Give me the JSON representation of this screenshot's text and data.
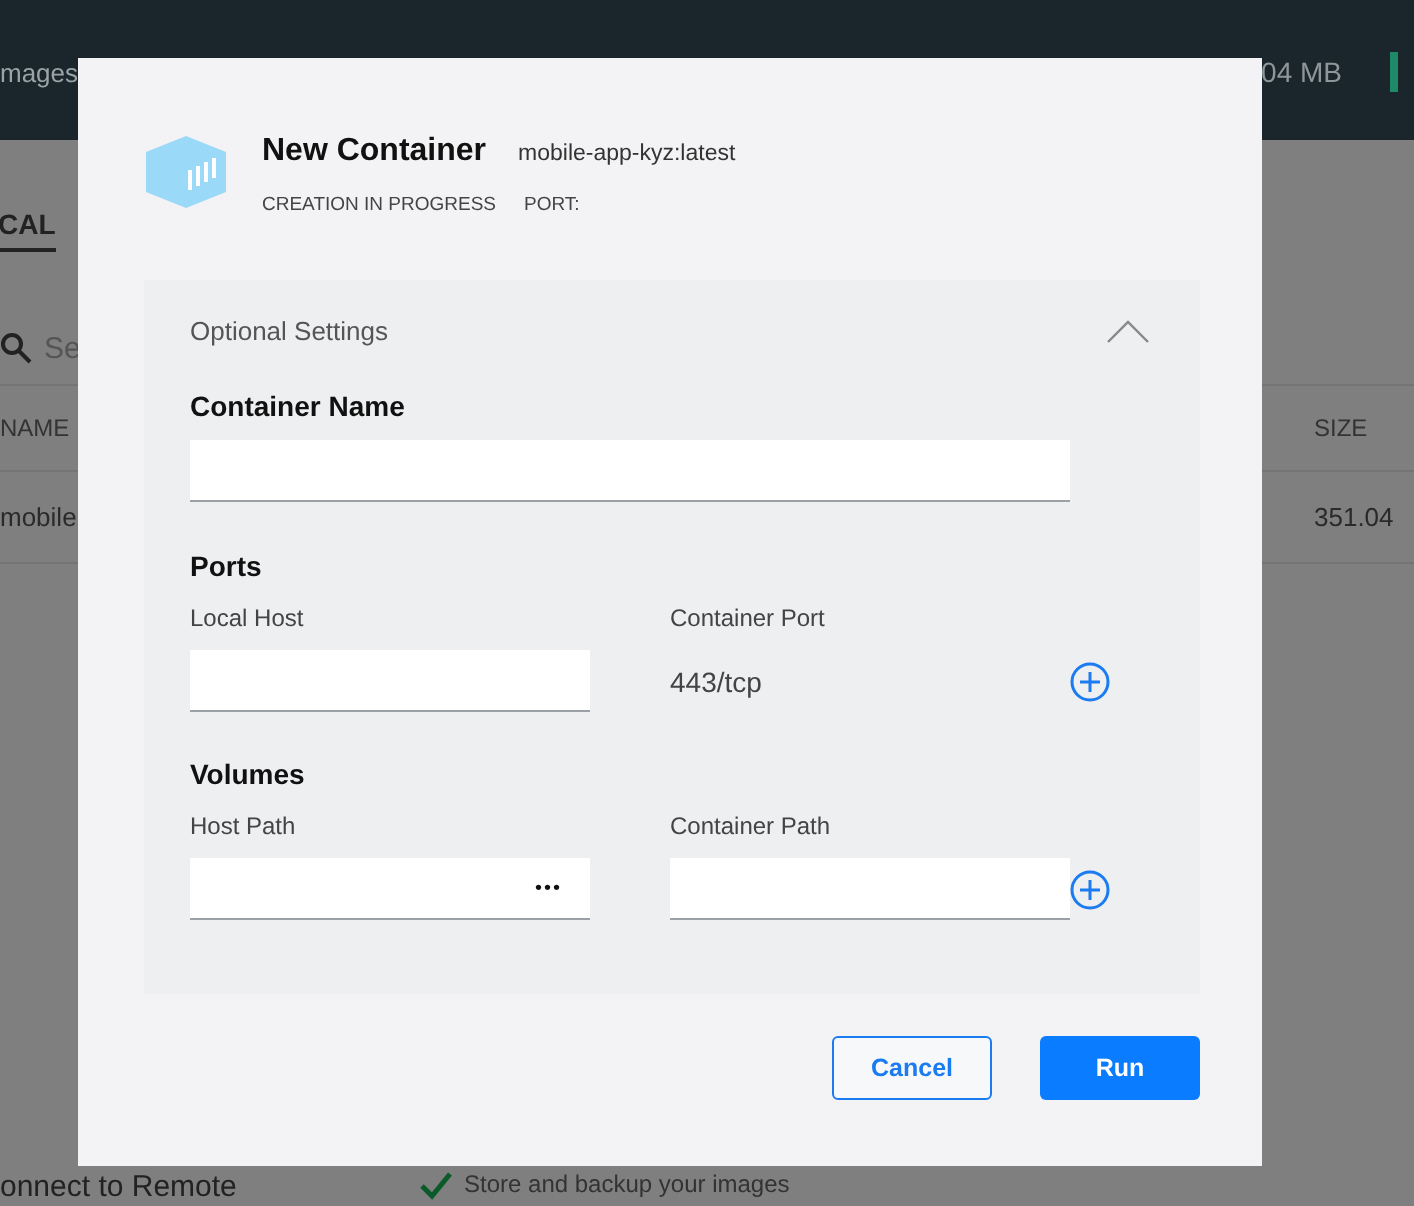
{
  "background": {
    "header_title": "mages",
    "header_size": "04 MB",
    "tab": "CAL",
    "search_placeholder": "Se",
    "columns": [
      "NAME",
      "SIZE"
    ],
    "row": [
      "mobile",
      "351.04"
    ],
    "remote_title": "onnect to Remote",
    "remote_feature": "Store and backup your images"
  },
  "dialog": {
    "title": "New Container",
    "image": "mobile-app-kyz:latest",
    "status": "CREATION IN PROGRESS",
    "port_label": "PORT:",
    "section": {
      "title": "Optional Settings",
      "expanded": true
    },
    "container_name_label": "Container Name",
    "ports": {
      "title": "Ports",
      "local_host_label": "Local Host",
      "container_port_label": "Container Port",
      "container_port": "443/tcp"
    },
    "volumes": {
      "title": "Volumes",
      "host_path_label": "Host Path",
      "container_path_label": "Container Path",
      "browse": "•••"
    },
    "buttons": [
      {
        "label": "Cancel",
        "kind": "secondary"
      },
      {
        "label": "Run",
        "kind": "primary"
      }
    ]
  }
}
